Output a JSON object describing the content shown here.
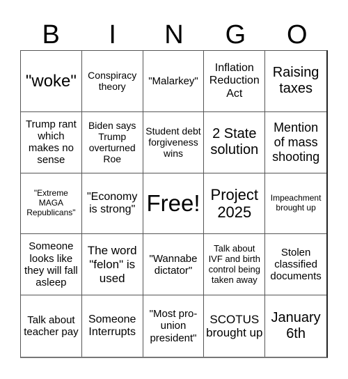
{
  "header": [
    "B",
    "I",
    "N",
    "G",
    "O"
  ],
  "cells": [
    "\"woke\"",
    "Conspiracy theory",
    "\"Malarkey\"",
    "Inflation Reduction Act",
    "Raising taxes",
    "Trump rant which makes no sense",
    "Biden says Trump overturned Roe",
    "Student debt forgiveness wins",
    "2 State solution",
    "Mention of mass shooting",
    "\"Extreme MAGA Republicans\"",
    "\"Economy is strong\"",
    "Free!",
    "Project 2025",
    "Impeachment brought up",
    "Someone looks like they will fall asleep",
    "The word \"felon\" is used",
    "\"Wannabe dictator\"",
    "Talk about IVF and birth control being taken away",
    "Stolen classified documents",
    "Talk about teacher pay",
    "Someone Interrupts",
    "\"Most pro-union president\"",
    "SCOTUS brought up",
    "January 6th"
  ]
}
